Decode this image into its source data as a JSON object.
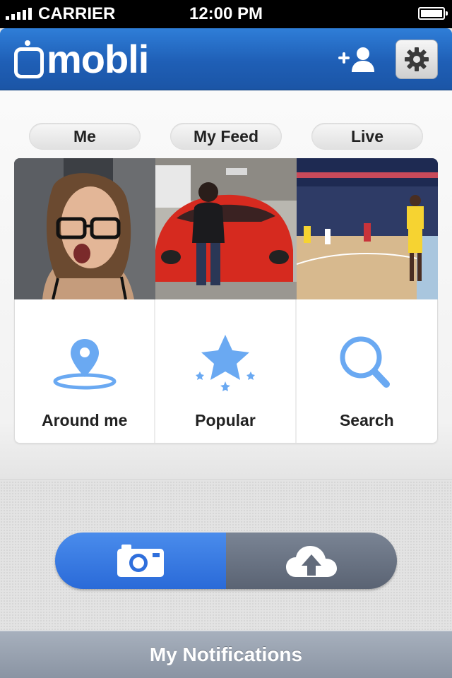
{
  "status_bar": {
    "carrier": "CARRIER",
    "time": "12:00 PM"
  },
  "header": {
    "logo_text": "mobli",
    "add_user_icon": "add-user-icon",
    "settings_icon": "gear-icon"
  },
  "tabs": [
    {
      "label": "Me"
    },
    {
      "label": "My Feed"
    },
    {
      "label": "Live"
    }
  ],
  "photos": [
    {
      "subject": "selfie"
    },
    {
      "subject": "red sports car"
    },
    {
      "subject": "basketball game"
    }
  ],
  "actions": [
    {
      "label": "Around me",
      "icon": "location-pin-icon"
    },
    {
      "label": "Popular",
      "icon": "star-icon"
    },
    {
      "label": "Search",
      "icon": "search-icon"
    }
  ],
  "capture_toggle": {
    "camera_icon": "camera-icon",
    "upload_icon": "cloud-upload-icon"
  },
  "footer": {
    "notifications_label": "My Notifications"
  },
  "colors": {
    "header_blue": "#1f5fb6",
    "accent_blue": "#6aa9f2",
    "camera_blue": "#2a6ad8",
    "upload_gray": "#5a6373"
  }
}
